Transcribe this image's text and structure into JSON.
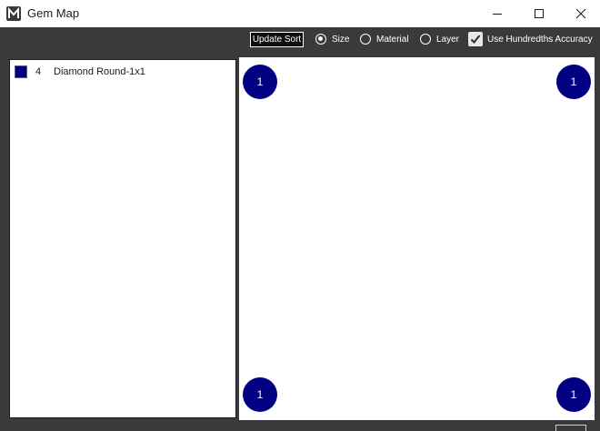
{
  "window": {
    "title": "Gem Map",
    "icon": "m-logo-icon"
  },
  "toolbar": {
    "update_sort_label": "Update Sort",
    "sort_options": [
      {
        "label": "Size",
        "selected": true
      },
      {
        "label": "Material",
        "selected": false
      },
      {
        "label": "Layer",
        "selected": false
      }
    ],
    "hundredths_label": "Use Hundredths Accuracy",
    "hundredths_checked": true
  },
  "gem_list": [
    {
      "count": "4",
      "name": "Diamond Round-1x1",
      "color": "#000080"
    }
  ],
  "map": {
    "gems": [
      {
        "label": "1",
        "color": "#000080"
      },
      {
        "label": "1",
        "color": "#000080"
      },
      {
        "label": "1",
        "color": "#000080"
      },
      {
        "label": "1",
        "color": "#000080"
      }
    ]
  },
  "colors": {
    "toolbar_bg": "#3a3a3c",
    "gem": "#000080"
  }
}
